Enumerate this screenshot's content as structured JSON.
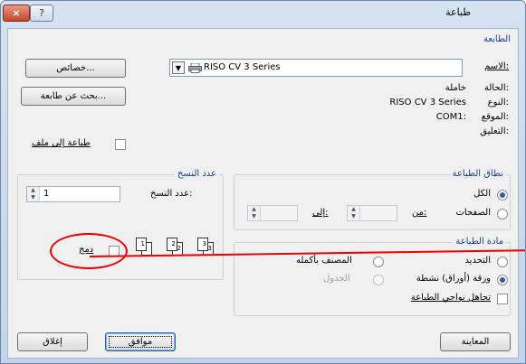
{
  "window": {
    "title": "طباعة",
    "close_label": "×",
    "help_label": "?"
  },
  "printer": {
    "group_title": "الطابعة",
    "name_label": "الاسم:",
    "name_value": "RISO CV 3 Series",
    "properties_button": "خصائص...",
    "find_printer_button": "بحث عن طابعة...",
    "status_label": "الحالة:",
    "status_value": "خاملة",
    "type_label": "النوع:",
    "type_value": "RISO CV 3 Series",
    "where_label": "الموقع:",
    "where_value": "COM1:",
    "comment_label": "التعليق:",
    "print_to_file_label": "طباعة إلى ملف"
  },
  "print_range": {
    "group_title": "نطاق الطباعة",
    "all_label": "الكل",
    "pages_label": "الصفحات",
    "from_label": "من:",
    "to_label": "إلى:"
  },
  "copies": {
    "group_title": "عدد النسخ",
    "number_label": "عدد النسخ:",
    "number_value": "1",
    "collate_label": "دمج",
    "page_icons": [
      "1",
      "1",
      "2",
      "2",
      "3",
      "3"
    ]
  },
  "print_what": {
    "group_title": "مادة الطباعة",
    "selection_label": "التحديد",
    "entire_workbook_label": "المصنف بأكمله",
    "active_sheets_label": "ورقة (أوراق) نشطة",
    "table_label": "الجدول",
    "ignore_print_areas_label": "تجاهل نواحي الطباعة"
  },
  "footer": {
    "preview_button": "المعاينة",
    "ok_button": "موافق",
    "close_button": "إغلاق"
  },
  "colors": {
    "group_title": "#1a3e8c",
    "callout": "#e00000"
  },
  "icons": {
    "close": "close-icon",
    "help": "help-icon",
    "printer": "printer-icon",
    "dropdown": "chevron-down-icon",
    "spin": "spin-arrows-icon",
    "pages": "page-stack-icon"
  }
}
